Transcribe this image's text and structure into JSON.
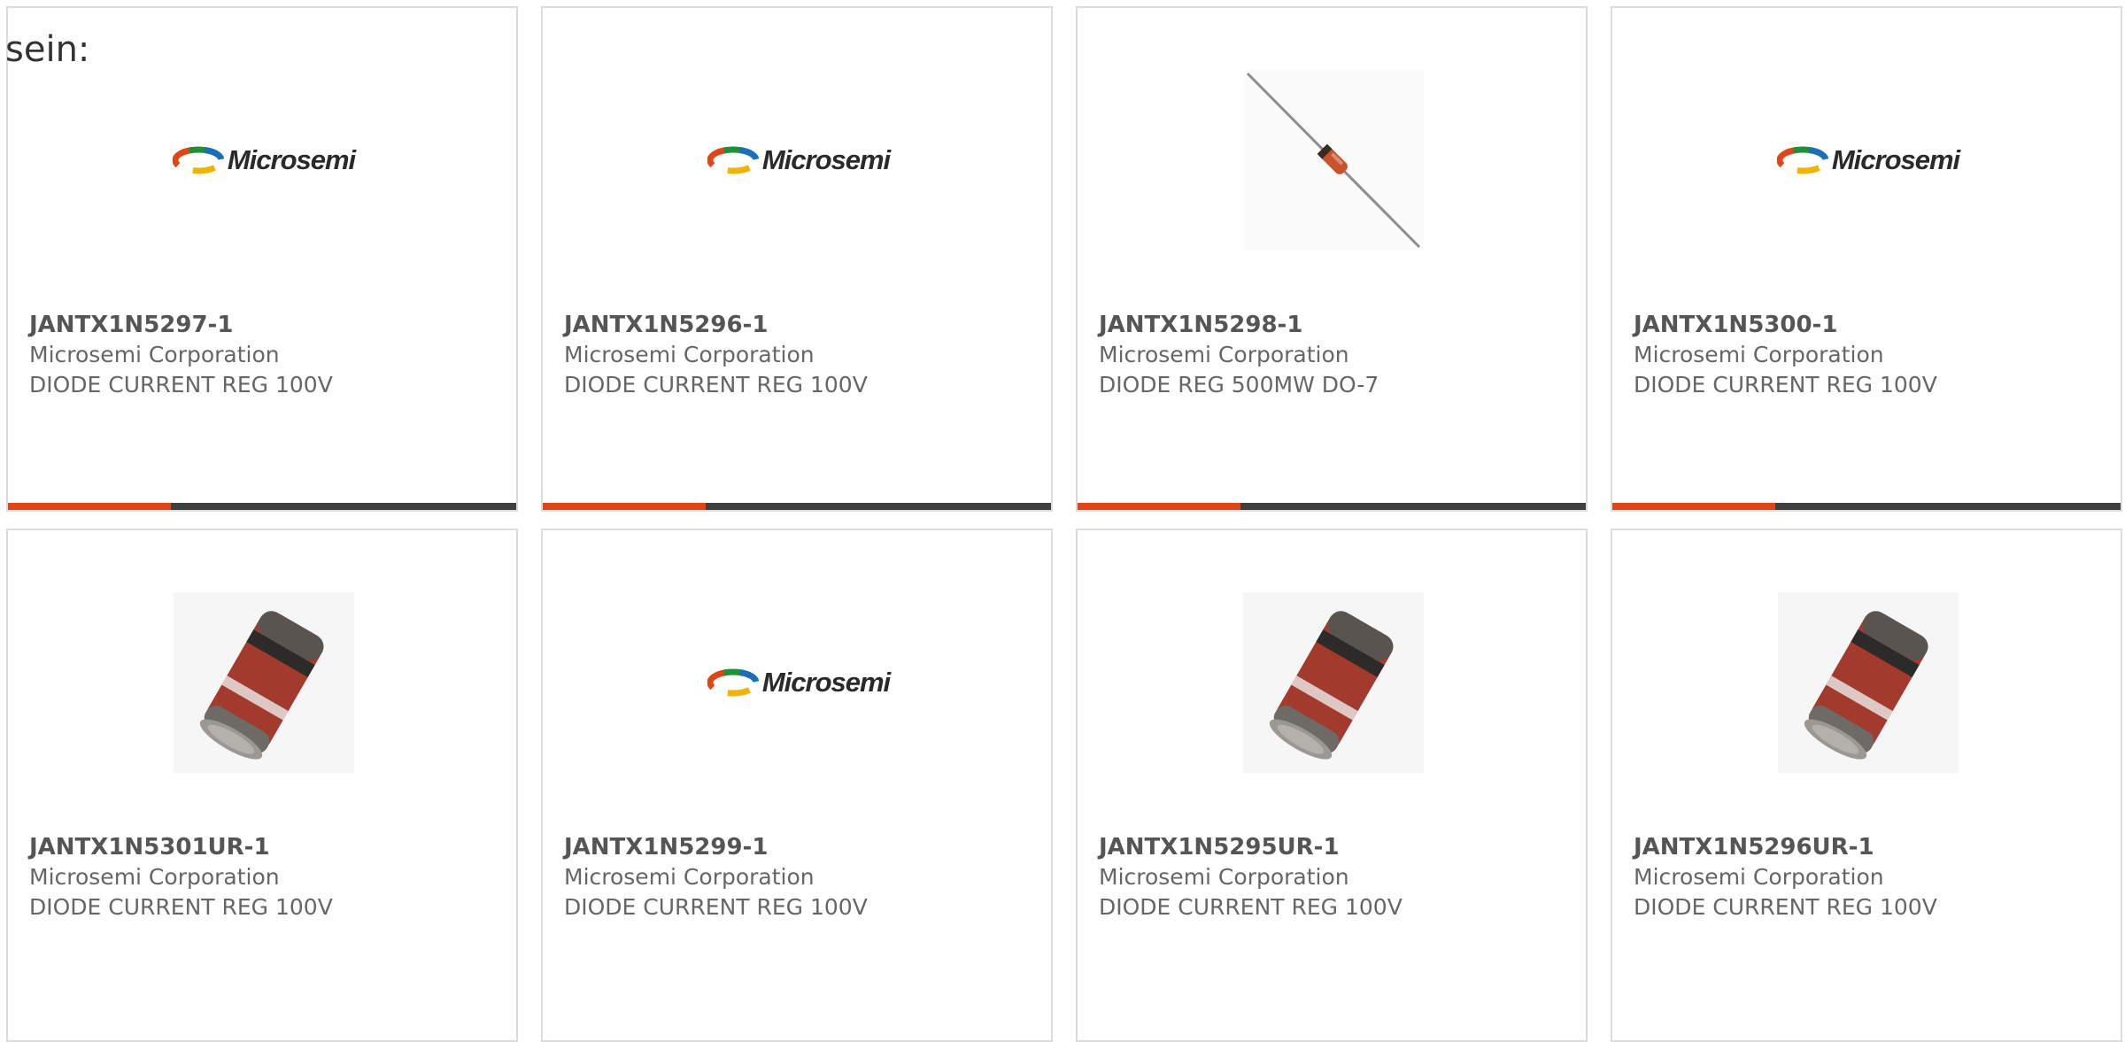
{
  "intro_text": "sein:",
  "brand": {
    "logo_text": "Microsemi",
    "accent_color": "#e04517",
    "bar_color": "#3f3f3f"
  },
  "products": [
    {
      "part": "JANTX1N5297-1",
      "manufacturer": "Microsemi Corporation",
      "description": "DIODE CURRENT REG 100V",
      "image": "microsemi-logo",
      "progress": 0.32
    },
    {
      "part": "JANTX1N5296-1",
      "manufacturer": "Microsemi Corporation",
      "description": "DIODE CURRENT REG 100V",
      "image": "microsemi-logo",
      "progress": 0.32
    },
    {
      "part": "JANTX1N5298-1",
      "manufacturer": "Microsemi Corporation",
      "description": "DIODE REG 500MW DO-7",
      "image": "axial-diode-photo",
      "progress": 0.32
    },
    {
      "part": "JANTX1N5300-1",
      "manufacturer": "Microsemi Corporation",
      "description": "DIODE CURRENT REG 100V",
      "image": "microsemi-logo",
      "progress": 0.32
    },
    {
      "part": "JANTX1N5301UR-1",
      "manufacturer": "Microsemi Corporation",
      "description": "DIODE CURRENT REG 100V",
      "image": "melf-diode-photo"
    },
    {
      "part": "JANTX1N5299-1",
      "manufacturer": "Microsemi Corporation",
      "description": "DIODE CURRENT REG 100V",
      "image": "microsemi-logo"
    },
    {
      "part": "JANTX1N5295UR-1",
      "manufacturer": "Microsemi Corporation",
      "description": "DIODE CURRENT REG 100V",
      "image": "melf-diode-photo"
    },
    {
      "part": "JANTX1N5296UR-1",
      "manufacturer": "Microsemi Corporation",
      "description": "DIODE CURRENT REG 100V",
      "image": "melf-diode-photo"
    }
  ]
}
